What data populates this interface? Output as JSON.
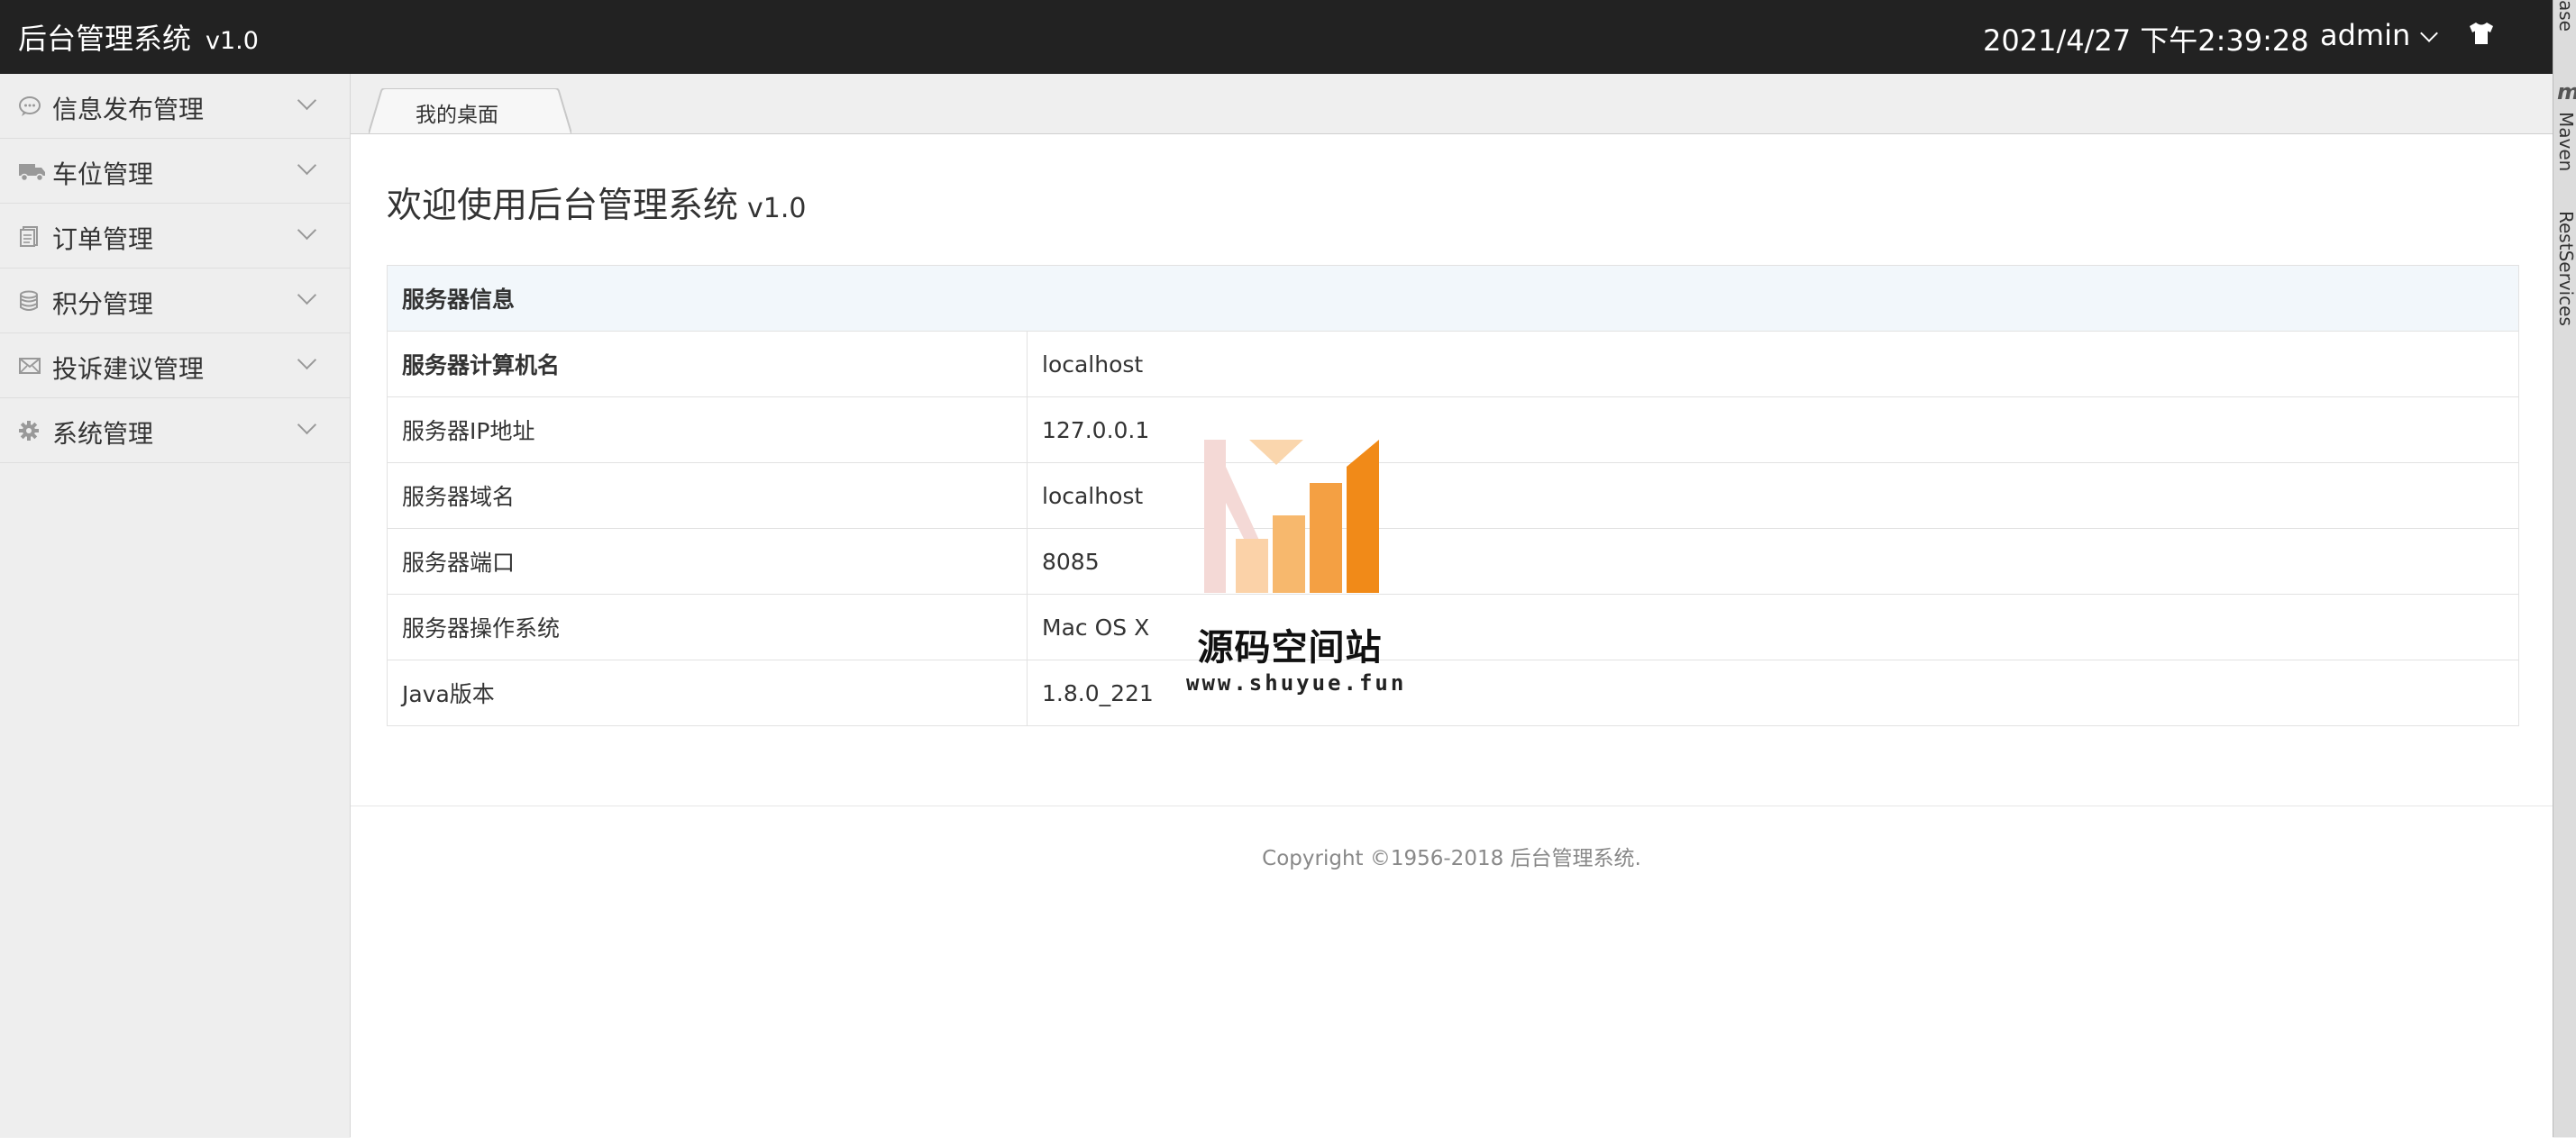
{
  "header": {
    "title": "后台管理系统",
    "version": "v1.0",
    "datetime": "2021/4/27 下午2:39:28",
    "user": "admin",
    "theme_icon": "tshirt-icon"
  },
  "ide_strip": {
    "labels": [
      "ase",
      "Maven",
      "RestServices"
    ],
    "maven_icon": "m"
  },
  "sidebar": {
    "items": [
      {
        "label": "信息发布管理",
        "icon": "message-icon"
      },
      {
        "label": "车位管理",
        "icon": "truck-icon"
      },
      {
        "label": "订单管理",
        "icon": "document-icon"
      },
      {
        "label": "积分管理",
        "icon": "database-icon"
      },
      {
        "label": "投诉建议管理",
        "icon": "mail-icon"
      },
      {
        "label": "系统管理",
        "icon": "gear-icon"
      }
    ]
  },
  "tabs": [
    {
      "label": "我的桌面",
      "active": true
    }
  ],
  "main": {
    "welcome_title": "欢迎使用后台管理系统",
    "welcome_version": "v1.0",
    "table": {
      "header": "服务器信息",
      "rows": [
        {
          "key": "服务器计算机名",
          "value": "localhost"
        },
        {
          "key": "服务器IP地址",
          "value": "127.0.0.1"
        },
        {
          "key": "服务器域名",
          "value": "localhost"
        },
        {
          "key": "服务器端口",
          "value": "8085"
        },
        {
          "key": "服务器操作系统",
          "value": "Mac OS X"
        },
        {
          "key": "Java版本",
          "value": "1.8.0_221"
        }
      ]
    },
    "copyright": "Copyright ©1956-2018 后台管理系统."
  },
  "watermark": {
    "name": "源码空间站",
    "url": "www.shuyue.fun"
  },
  "colors": {
    "header_bg": "#222222",
    "sidebar_bg": "#eeeeee",
    "table_head_bg": "#f2f7fb",
    "watermark_orange": "#f39a2e"
  }
}
